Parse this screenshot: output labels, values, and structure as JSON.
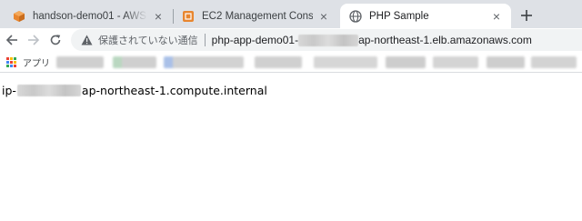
{
  "tabs": [
    {
      "title": "handson-demo01 - AWS Cloud",
      "favicon": "aws-cube-icon",
      "active": false
    },
    {
      "title": "EC2 Management Console",
      "favicon": "aws-ec2-icon",
      "active": false
    },
    {
      "title": "PHP Sample",
      "favicon": "globe-icon",
      "active": true
    }
  ],
  "toolbar": {
    "security_text": "保護されていない通信",
    "url_prefix": "php-app-demo01-",
    "url_suffix": "ap-northeast-1.elb.amazonaws.com"
  },
  "bookmarks": {
    "apps_label": "アプリ"
  },
  "page": {
    "hostname_prefix": "ip-",
    "hostname_suffix": "ap-northeast-1.compute.internal"
  },
  "colors": {
    "tabstrip_bg": "#dee1e6",
    "omnibox_bg": "#f1f3f4",
    "aws_orange": "#e8862f",
    "active_text": "#202124"
  }
}
